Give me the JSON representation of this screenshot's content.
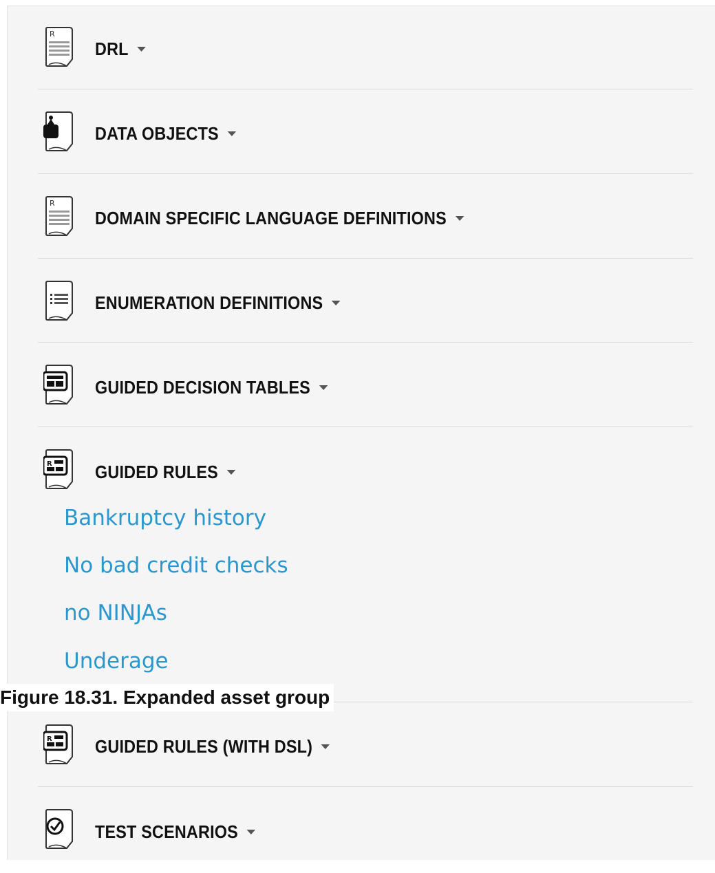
{
  "asset_groups": [
    {
      "title": "DRL",
      "icon": "drl-icon"
    },
    {
      "title": "DATA OBJECTS",
      "icon": "data-object-icon"
    },
    {
      "title": "DOMAIN SPECIFIC LANGUAGE DEFINITIONS",
      "icon": "dsl-icon"
    },
    {
      "title": "ENUMERATION DEFINITIONS",
      "icon": "enumeration-icon"
    },
    {
      "title": "GUIDED DECISION TABLES",
      "icon": "decision-table-icon"
    },
    {
      "title": "GUIDED RULES",
      "icon": "guided-rule-icon",
      "expanded": true,
      "items": [
        "Bankruptcy history",
        "No bad credit checks",
        "no NINJAs",
        "Underage"
      ]
    },
    {
      "title": "GUIDED RULES (WITH DSL)",
      "icon": "guided-rule-dsl-icon"
    },
    {
      "title": "TEST SCENARIOS",
      "icon": "test-scenario-icon"
    }
  ],
  "caption": "Figure 18.31. Expanded asset group",
  "colors": {
    "link": "#2b97cc",
    "panel": "#f5f5f5",
    "divider": "#dcdcdc"
  }
}
